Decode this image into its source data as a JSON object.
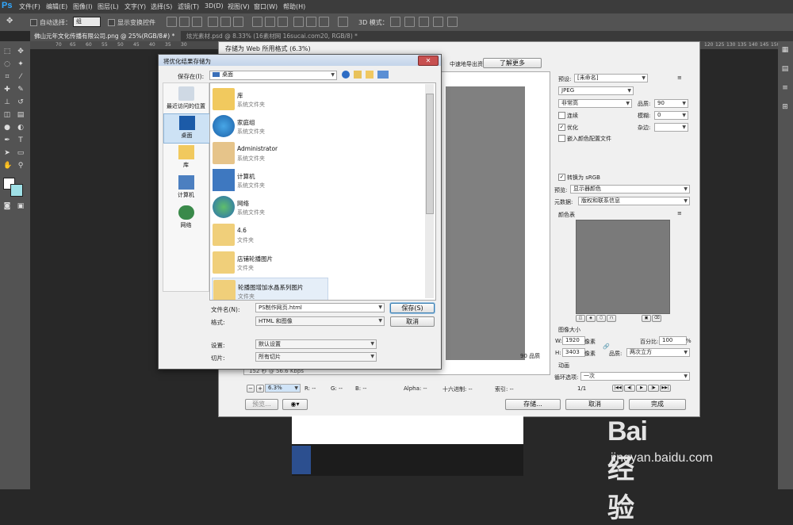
{
  "app": {
    "logo": "Ps"
  },
  "menu": [
    "文件(F)",
    "编辑(E)",
    "图像(I)",
    "图层(L)",
    "文字(Y)",
    "选择(S)",
    "滤镜(T)",
    "3D(D)",
    "视图(V)",
    "窗口(W)",
    "帮助(H)"
  ],
  "options_bar": {
    "auto_select_label": "自动选择：",
    "auto_select_value": "组",
    "show_transform_label": "显示变换控件",
    "mode_3d_label": "3D 模式："
  },
  "tabs": [
    "佛山元年文化传播有限公司.png @ 25%(RGB/8#) *",
    "炫光素材.psd @ 8.33% (16素材网 16sucai.com20, RGB/8) *"
  ],
  "ruler": {
    "left": [
      "70",
      "65",
      "60",
      "55",
      "50",
      "45",
      "40",
      "35",
      "30"
    ],
    "right": [
      "120",
      "125",
      "130",
      "135",
      "140",
      "145",
      "150",
      "155"
    ]
  },
  "save_for_web": {
    "title": "存储为 Web 所用格式 (6.3%)",
    "banner_text": "中速地导出资源",
    "learn_more_button": "了解更多",
    "preset_label": "预设:",
    "preset_value": "[未命名]",
    "format_value": "JPEG",
    "quality_preset": "非常高",
    "quality_label": "品质:",
    "quality_value": "90",
    "progressive_label": "连续",
    "blur_label": "模糊:",
    "blur_value": "0",
    "optimized_label": "优化",
    "matte_label": "杂边:",
    "embed_profile_label": "嵌入颜色配置文件",
    "convert_srgb_label": "转换为 sRGB",
    "preview_label": "预览:",
    "preview_value": "显示器颜色",
    "metadata_label": "元数据:",
    "metadata_value": "版权和联系信息",
    "color_table_label": "颜色表",
    "image_size_label": "图像大小",
    "width_label": "W:",
    "width_value": "1920",
    "height_label": "H:",
    "height_value": "3403",
    "pixel_unit": "像素",
    "percent_label": "百分比:",
    "percent_value": "100",
    "percent_unit": "%",
    "quality_label2": "品质:",
    "resample_value": "两次立方",
    "animation_label": "动画",
    "loop_label": "循环选项:",
    "loop_value": "一次",
    "frame_counter": "1/1",
    "preview_info": "90 品质",
    "size_info": "152 秒 @ 56.6 Kbps",
    "zoom_value": "6.3%",
    "channels": {
      "r": "R: --",
      "g": "G: --",
      "b": "B: --",
      "alpha": "Alpha: --",
      "hex": "十六进制: --",
      "index": "索引: --"
    },
    "preview_button": "预览...",
    "store_button": "存储...",
    "cancel_button": "取消",
    "done_button": "完成"
  },
  "file_dialog": {
    "title": "将优化结果存储为",
    "save_in_label": "保存在(I):",
    "save_in_value": "桌面",
    "places": [
      "最近访问的位置",
      "桌面",
      "库",
      "计算机",
      "网络"
    ],
    "files": [
      {
        "name": "库",
        "type": "系统文件夹"
      },
      {
        "name": "家庭组",
        "type": "系统文件夹"
      },
      {
        "name": "Administrator",
        "type": "系统文件夹"
      },
      {
        "name": "计算机",
        "type": "系统文件夹"
      },
      {
        "name": "网络",
        "type": "系统文件夹"
      },
      {
        "name": "4.6",
        "type": "文件夹"
      },
      {
        "name": "店铺轮播图片",
        "type": "文件夹"
      },
      {
        "name": "轮播图增加水晶系列图片",
        "type": "文件夹"
      }
    ],
    "filename_label": "文件名(N):",
    "filename_value": "PS制作网页.html",
    "format_label": "格式:",
    "format_value": "HTML 和图像",
    "settings_label": "设置:",
    "settings_value": "默认设置",
    "slices_label": "切片:",
    "slices_value": "所有切片",
    "save_button": "保存(S)",
    "cancel_button": "取消"
  },
  "watermark": {
    "logo": "Bai经验",
    "url": "jingyan.baidu.com"
  }
}
